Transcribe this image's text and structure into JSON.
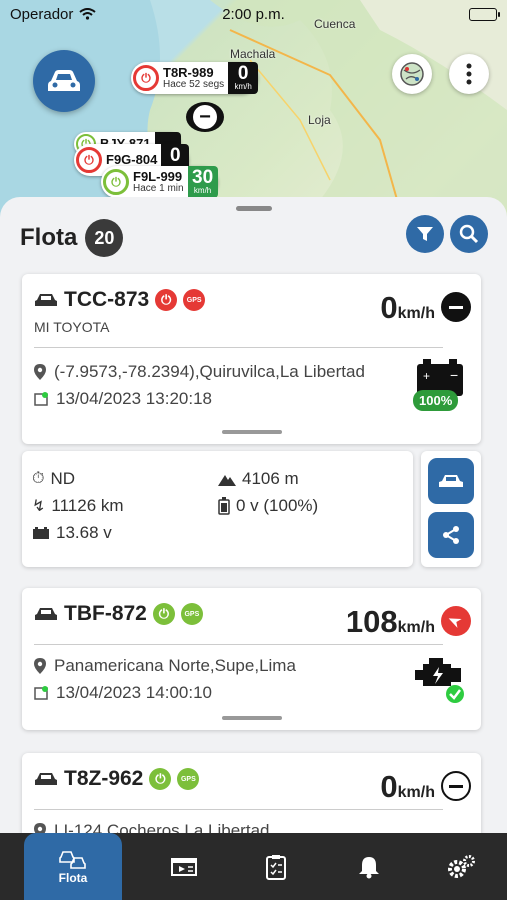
{
  "status_bar": {
    "carrier": "Operador",
    "time": "2:00 p.m."
  },
  "map": {
    "cities": [
      "Cuenca",
      "Machala",
      "Loja"
    ],
    "markers": [
      {
        "plate": "T8R-989",
        "ago": "Hace 52 segs",
        "speed": "0",
        "unit": "km/h",
        "color": "#e53935"
      },
      {
        "plate": "BJY-871",
        "ago": "",
        "speed": "",
        "unit": "",
        "color": "#7cbf3a"
      },
      {
        "plate": "F9G-804",
        "ago": "",
        "speed": "0",
        "unit": "",
        "color": "#e53935"
      },
      {
        "plate": "F9L-999",
        "ago": "Hace 1 min",
        "speed": "30",
        "unit": "km/h",
        "color": "#7cbf3a"
      }
    ],
    "cluster_symbol": "−"
  },
  "sheet": {
    "title": "Flota",
    "count": "20"
  },
  "vehicles": [
    {
      "plate": "TCC-873",
      "alias": "MI TOYOTA",
      "gps": "GPS",
      "speed": "0",
      "unit": "km/h",
      "location": "(-7.9573,-78.2394),Quiruvilca,La Libertad",
      "datetime": "13/04/2023 13:20:18",
      "battery": "100%",
      "state_color": "#e53935"
    },
    {
      "plate": "TBF-872",
      "alias": "",
      "gps": "GPS",
      "speed": "108",
      "unit": "km/h",
      "location": "Panamericana Norte,Supe,Lima",
      "datetime": "13/04/2023 14:00:10",
      "state_color": "#7cbf3a"
    },
    {
      "plate": "T8Z-962",
      "alias": "",
      "gps": "GPS",
      "speed": "0",
      "unit": "km/h",
      "location": "LI-124,Cocheros,La Libertad",
      "state_color": "#7cbf3a"
    }
  ],
  "detail": {
    "odometer_state": "ND",
    "altitude": "4106 m",
    "distance": "11126 km",
    "battery_internal": "0 v (100%)",
    "voltage": "13.68 v"
  },
  "tabs": [
    {
      "label": "Flota",
      "icon": "fleet-icon"
    },
    {
      "label": "",
      "icon": "media-icon"
    },
    {
      "label": "",
      "icon": "report-icon"
    },
    {
      "label": "",
      "icon": "bell-icon"
    },
    {
      "label": "",
      "icon": "settings-icon"
    }
  ],
  "colors": {
    "accent": "#2f6aa6",
    "on": "#7cbf3a",
    "off": "#e53935",
    "tabbar": "#2a2a2a"
  }
}
